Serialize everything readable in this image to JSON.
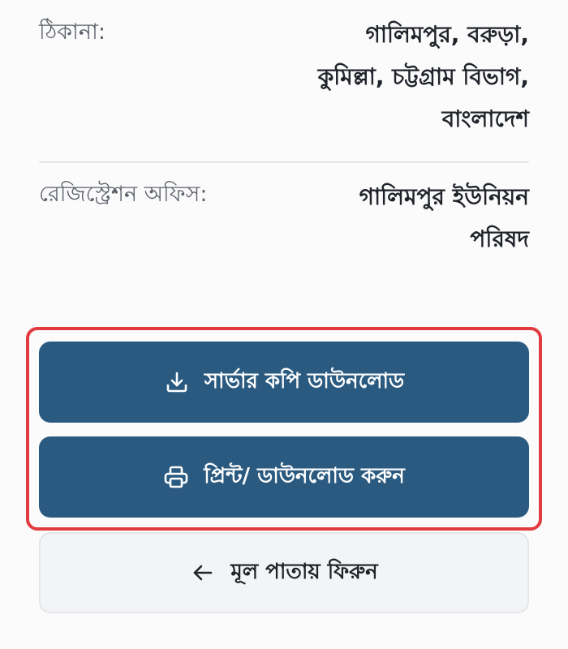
{
  "address": {
    "label": "ঠিকানা:",
    "value_lines": [
      "গালিমপুর, বরুড়া,",
      "কুমিল্লা, চট্টগ্রাম বিভাগ,",
      "বাংলাদেশ"
    ]
  },
  "registration_office": {
    "label": "রেজিস্ট্রেশন অফিস:",
    "value_lines": [
      "গালিমপুর ইউনিয়ন",
      "পরিষদ"
    ]
  },
  "actions": {
    "server_copy_download": "সার্ভার কপি ডাউনলোড",
    "print_download": "প্রিন্ট/ ডাউনলোড করুন",
    "back_home": "মূল পাতায় ফিরুন"
  },
  "icons": {
    "download": "download-icon",
    "print": "printer-icon",
    "back": "arrow-left-icon"
  },
  "colors": {
    "primary_button": "#2b5a80",
    "highlight_border": "#e23a3f",
    "secondary_button": "#f3f4f6"
  }
}
